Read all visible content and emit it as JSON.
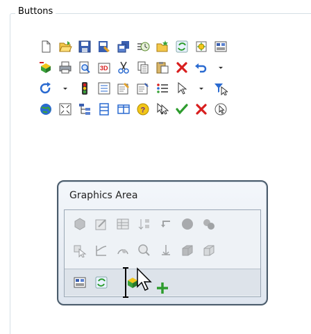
{
  "groupbox": {
    "title": "Buttons"
  },
  "buttons_rows": [
    [
      "new-document-icon",
      "open-folder-icon",
      "save-icon",
      "print-setup-icon",
      "copy-icon",
      "recent-icon",
      "open-folder-star-icon",
      "rebuild-icon",
      "options-icon",
      "customize-icon"
    ],
    [
      "import-icon",
      "print-icon",
      "print-preview-icon",
      "3d-icon",
      "cut-icon",
      "copy-clipboard-icon",
      "paste-icon",
      "delete-icon",
      "undo-icon",
      "undo-dropdown-icon"
    ],
    [
      "redo-icon",
      "redo-dropdown-icon",
      "traffic-light-icon",
      "properties-icon",
      "edit-properties-icon",
      "file-properties-icon",
      "list-icon",
      "select-icon",
      "select-dropdown-icon",
      "filter-icon"
    ],
    [
      "globe-icon",
      "zoom-fit-icon",
      "tree-icon",
      "split-vertical-icon",
      "split-horizontal-icon",
      "help-icon",
      "cursor-select-icon",
      "check-icon",
      "close-icon",
      "clock-cursor-icon"
    ]
  ],
  "panel": {
    "title": "Graphics Area",
    "rows": [
      [
        "section-view-icon",
        "sketch-icon",
        "table-icon",
        "sort-icon",
        "return-icon",
        "sphere-icon",
        "spheres-icon"
      ],
      [
        "select-arrow-icon",
        "curve-icon",
        "rotate-view-icon",
        "zoom-area-icon",
        "anchor-icon",
        "shaded-box-icon",
        "box-icon"
      ],
      [
        "customize-panel-icon",
        "rebuild-green-icon",
        "cube-drop-icon"
      ]
    ]
  },
  "colors": {
    "panel_border": "#4a5b6b",
    "panel_bg": "#e6ecf3",
    "red": "#d81e1e",
    "green": "#2e9c2e",
    "blue": "#2a6ad0",
    "yellow": "#f2c618"
  }
}
